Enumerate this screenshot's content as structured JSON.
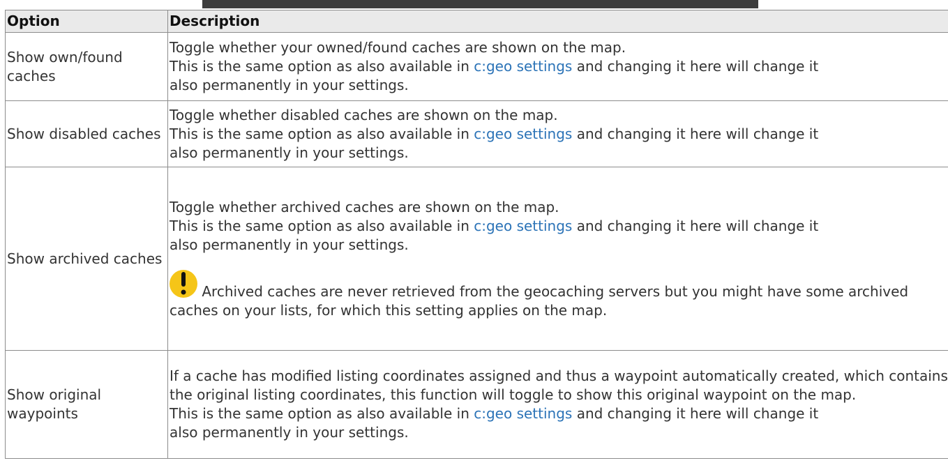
{
  "table": {
    "headers": [
      "Option",
      "Description"
    ],
    "rows": [
      {
        "option": "Show own/found caches",
        "desc_before": "Toggle whether your owned/found caches are shown on the map.",
        "line2_prefix": "This is the same option as also available in ",
        "link": "c:geo settings",
        "line2_suffix": " and changing it here will change it",
        "line3": "also permanently in your settings."
      },
      {
        "option": "Show disabled caches",
        "desc_before": "Toggle whether disabled caches are shown on the map.",
        "line2_prefix": "This is the same option as also available in ",
        "link": "c:geo settings",
        "line2_suffix": " and changing it here will change it",
        "line3": "also permanently in your settings."
      },
      {
        "option": "Show archived caches",
        "desc_before": "Toggle whether archived caches are shown on the map.",
        "line2_prefix": "This is the same option as also available in ",
        "link": "c:geo settings",
        "line2_suffix": " and changing it here will change it",
        "line3": "also permanently in your settings.",
        "note": " Archived caches are never retrieved from the geocaching servers but you might have some archived caches on your lists, for which this setting applies on the map."
      },
      {
        "option": "Show original waypoints",
        "desc_before": "If a cache has modified listing coordinates assigned and thus a waypoint automatically created, which contains the original listing coordinates, this function will toggle to show this original waypoint on the map.",
        "line2_prefix": "This is the same option as also available in ",
        "link": "c:geo settings",
        "line2_suffix": " and changing it here will change it",
        "line3": "also permanently in your settings."
      }
    ]
  },
  "icons": {
    "warning": "exclamation-warning-icon"
  },
  "colors": {
    "link": "#2b73b7",
    "warning": "#f5c518",
    "header_bg": "#eaeaea",
    "top_bar": "#3c3c3c"
  }
}
